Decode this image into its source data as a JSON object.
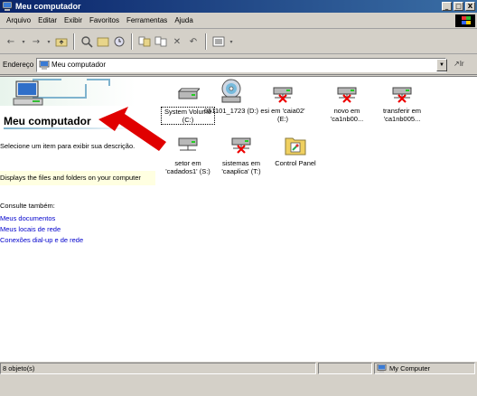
{
  "window": {
    "title": "Meu computador",
    "controls": [
      "_",
      "□",
      "X"
    ]
  },
  "menu": [
    "Arquivo",
    "Editar",
    "Exibir",
    "Favoritos",
    "Ferramentas",
    "Ajuda"
  ],
  "address": {
    "label": "Endereço",
    "value": "Meu computador",
    "go_label": "Ir"
  },
  "left_panel": {
    "title": "Meu computador",
    "hint": "Selecione um item para exibir sua descrição.",
    "info": "Displays the files and folders on your computer",
    "see_also_label": "Consulte também:",
    "links": [
      "Meus documentos",
      "Meus locais de rede",
      "Conexões dial-up e de rede"
    ]
  },
  "items": [
    {
      "label": "System Volume (C:)",
      "icon": "hard-drive-icon"
    },
    {
      "label": "051101_1723 (D:)",
      "icon": "cd-drive-icon"
    },
    {
      "label": "esi em 'caia02' (E:)",
      "icon": "network-drive-disconnected-icon"
    },
    {
      "label": "novo em 'ca1nb00...",
      "icon": "network-drive-disconnected-icon"
    },
    {
      "label": "transferir em 'ca1nb005...",
      "icon": "network-drive-disconnected-icon"
    },
    {
      "label": "setor em 'cadados1' (S:)",
      "icon": "network-drive-icon"
    },
    {
      "label": "sistemas em 'caaplica' (T:)",
      "icon": "network-drive-disconnected-icon"
    },
    {
      "label": "Control Panel",
      "icon": "control-panel-icon"
    }
  ],
  "status": {
    "left": "8 objeto(s)",
    "right": "My Computer"
  },
  "colors": {
    "titlebar": "#0a246a",
    "link": "#0000cc",
    "info_bg": "#ffffe1",
    "arrow": "#e00000"
  }
}
